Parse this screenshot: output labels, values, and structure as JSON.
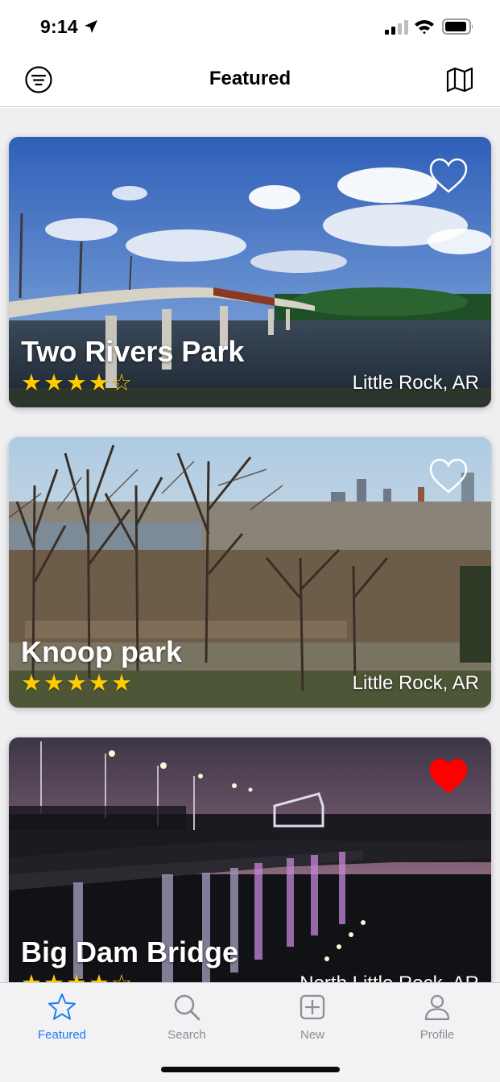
{
  "status_bar": {
    "time": "9:14",
    "icons": [
      "location-arrow-icon",
      "cellular-signal-icon",
      "wifi-icon",
      "battery-icon"
    ]
  },
  "nav": {
    "title": "Featured",
    "left_icon": "filter-menu-icon",
    "right_icon": "map-icon"
  },
  "cards": [
    {
      "title": "Two Rivers Park",
      "rating": 4,
      "stars_text": "★★★★☆",
      "location": "Little Rock, AR",
      "favorited": false
    },
    {
      "title": "Knoop park",
      "rating": 5,
      "stars_text": "★★★★★",
      "location": "Little Rock, AR",
      "favorited": false
    },
    {
      "title": "Big Dam Bridge",
      "rating": 4,
      "stars_text": "★★★★☆",
      "location": "North Little Rock, AR",
      "favorited": true
    }
  ],
  "tabs": [
    {
      "label": "Featured",
      "icon": "star-icon",
      "active": true
    },
    {
      "label": "Search",
      "icon": "magnifier-icon",
      "active": false
    },
    {
      "label": "New",
      "icon": "plus-square-icon",
      "active": false
    },
    {
      "label": "Profile",
      "icon": "person-icon",
      "active": false
    }
  ],
  "colors": {
    "accent": "#1e7cf2",
    "star": "#ffcc00",
    "heart_filled": "#ff0000",
    "tab_inactive": "#8e8e93"
  }
}
